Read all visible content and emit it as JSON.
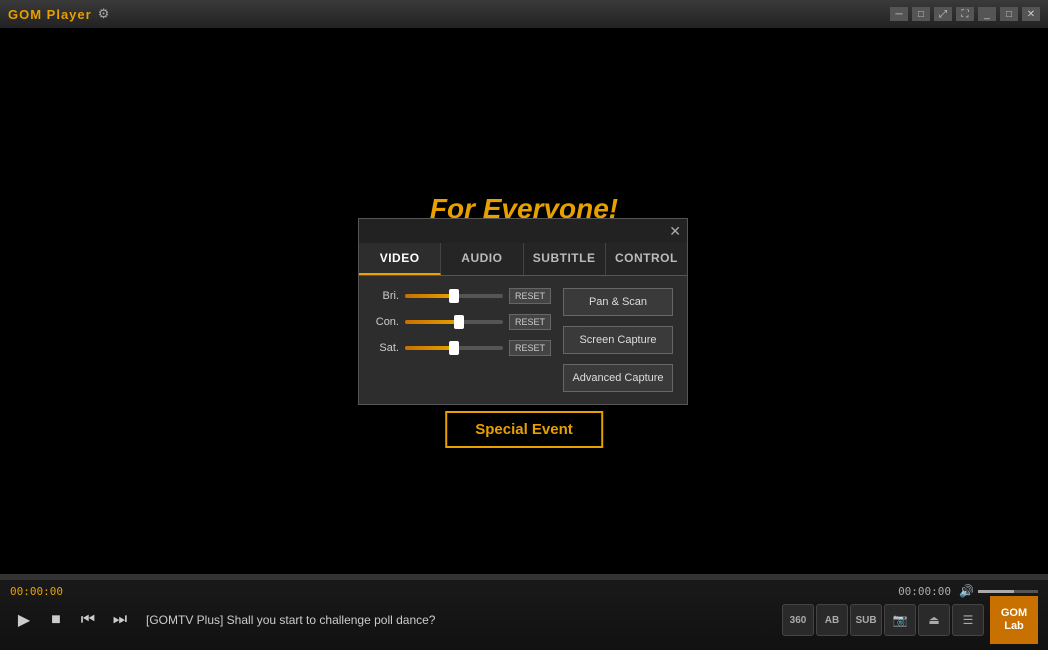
{
  "titlebar": {
    "app_name": "GOM Player",
    "gear_symbol": "⚙"
  },
  "video_area": {
    "promo_text": "For Everyone!",
    "special_event_label": "Special Event"
  },
  "dialog": {
    "close_symbol": "✕",
    "tabs": [
      {
        "id": "video",
        "label": "VIDEO",
        "active": true
      },
      {
        "id": "audio",
        "label": "AUDIO",
        "active": false
      },
      {
        "id": "subtitle",
        "label": "SUBTITLE",
        "active": false
      },
      {
        "id": "control",
        "label": "CONTROL",
        "active": false
      }
    ],
    "sliders": [
      {
        "label": "Bri.",
        "value": 50,
        "fill_pct": 50,
        "thumb_pct": 50
      },
      {
        "label": "Con.",
        "value": 55,
        "fill_pct": 55,
        "thumb_pct": 55
      },
      {
        "label": "Sat.",
        "value": 50,
        "fill_pct": 50,
        "thumb_pct": 50
      }
    ],
    "reset_label": "RESET",
    "buttons": [
      {
        "id": "pan-scan",
        "label": "Pan & Scan"
      },
      {
        "id": "screen-capture",
        "label": "Screen Capture"
      },
      {
        "id": "advanced-capture",
        "label": "Advanced Capture"
      }
    ]
  },
  "control_bar": {
    "time_left": "00:00:00",
    "time_right": "00:00:00",
    "song_title": "[GOMTV Plus] Shall you start to challenge poll dance?",
    "transport": {
      "play": "▶",
      "stop": "■",
      "prev": "⏮",
      "next": "⏭"
    },
    "icons": [
      {
        "id": "360",
        "label": "360"
      },
      {
        "id": "ab",
        "label": "AB"
      },
      {
        "id": "sub",
        "label": "SUB"
      },
      {
        "id": "cam",
        "label": "📷"
      },
      {
        "id": "eject",
        "label": "⏏"
      },
      {
        "id": "menu",
        "label": "☰"
      }
    ],
    "gom_logo": "GOM\nLab"
  }
}
